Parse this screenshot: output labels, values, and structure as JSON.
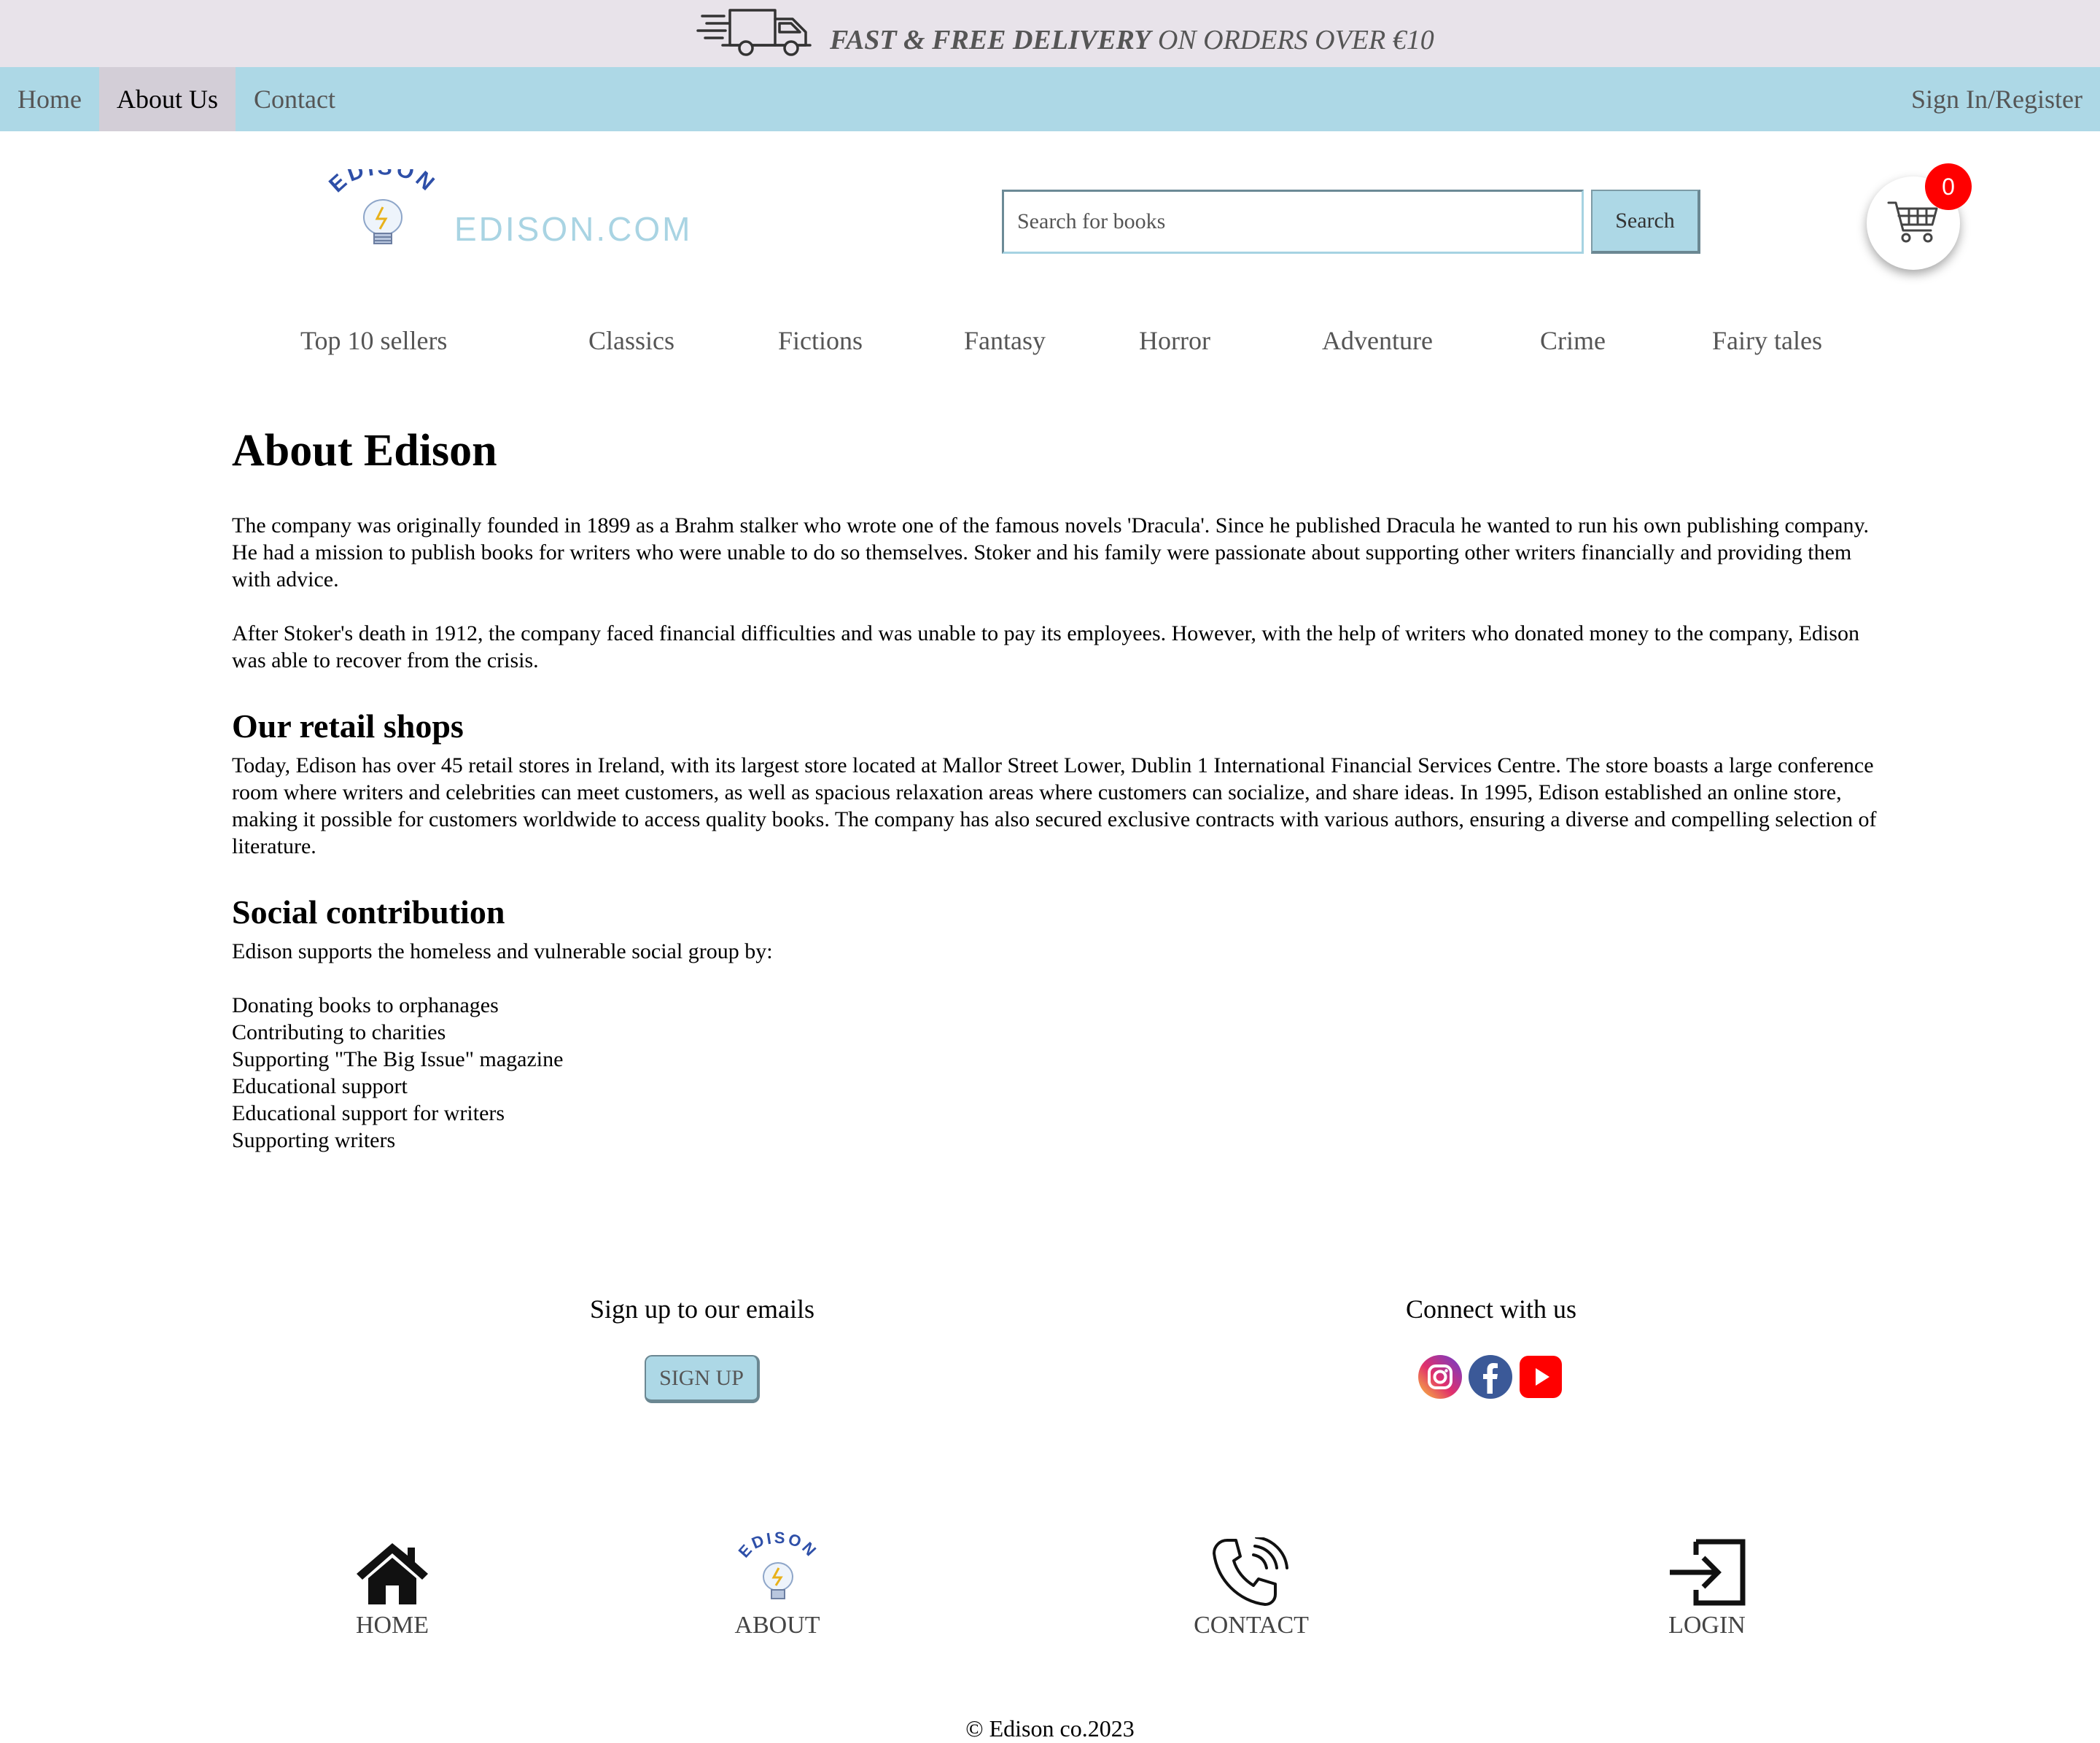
{
  "banner": {
    "bold_text": "FAST & FREE DELIVERY",
    "rest_text": " ON ORDERS OVER €10",
    "icon": "delivery-truck-icon"
  },
  "nav": {
    "items": [
      {
        "label": "Home",
        "active": false
      },
      {
        "label": "About Us",
        "active": true
      },
      {
        "label": "Contact",
        "active": false
      }
    ],
    "signin_label": "Sign In/Register"
  },
  "header": {
    "logo_arc_text": "EDISON",
    "logo_text": "EDISON.COM",
    "search_placeholder": "Search for books",
    "search_button": "Search",
    "cart_count": "0",
    "cart_icon": "shopping-cart-icon"
  },
  "categories": [
    "Top 10 sellers",
    "Classics",
    "Fictions",
    "Fantasy",
    "Horror",
    "Adventure",
    "Crime",
    "Fairy tales"
  ],
  "main": {
    "title": "About Edison",
    "intro_p1": "The company was originally founded in 1899 as a Brahm stalker who wrote one of the famous novels 'Dracula'. Since he published Dracula he wanted to run his own publishing company. He had a mission to publish books for writers who were unable to do so themselves. Stoker and his family were passionate about supporting other writers financially and providing them with advice.",
    "intro_p2": "After Stoker's death in 1912, the company faced financial difficulties and was unable to pay its employees. However, with the help of writers who donated money to the company, Edison was able to recover from the crisis.",
    "retail_heading": "Our retail shops",
    "retail_p": "Today, Edison has over 45 retail stores in Ireland, with its largest store located at Mallor Street Lower, Dublin 1 International Financial Services Centre. The store boasts a large conference room where writers and celebrities can meet customers, as well as spacious relaxation areas where customers can socialize, and share ideas. In 1995, Edison established an online store, making it possible for customers worldwide to access quality books. The company has also secured exclusive contracts with various authors, ensuring a diverse and compelling selection of literature.",
    "social_heading": "Social contribution",
    "social_intro": "Edison supports the homeless and vulnerable social group by:",
    "social_items": [
      "Donating books to orphanages",
      "Contributing to charities",
      "Supporting \"The Big Issue\" magazine",
      "Educational support",
      "Educational support for writers",
      "Supporting writers"
    ]
  },
  "footer": {
    "signup_heading": "Sign up to our emails",
    "signup_button": "SIGN UP",
    "connect_heading": "Connect with us",
    "social_icons": [
      "instagram-icon",
      "facebook-icon",
      "youtube-icon"
    ],
    "nav": [
      {
        "label": "HOME",
        "icon": "home-icon"
      },
      {
        "label": "ABOUT",
        "icon": "edison-logo-icon"
      },
      {
        "label": "CONTACT",
        "icon": "phone-icon"
      },
      {
        "label": "LOGIN",
        "icon": "login-icon"
      }
    ],
    "copyright": "© Edison co.2023"
  },
  "colors": {
    "banner_bg": "#e8e3ea",
    "nav_bg": "#add8e6",
    "nav_active_bg": "#d3ced7",
    "badge_red": "#ff0000",
    "logo_blue": "#2e4fa8",
    "logo_text_light": "#a9d4e3"
  }
}
